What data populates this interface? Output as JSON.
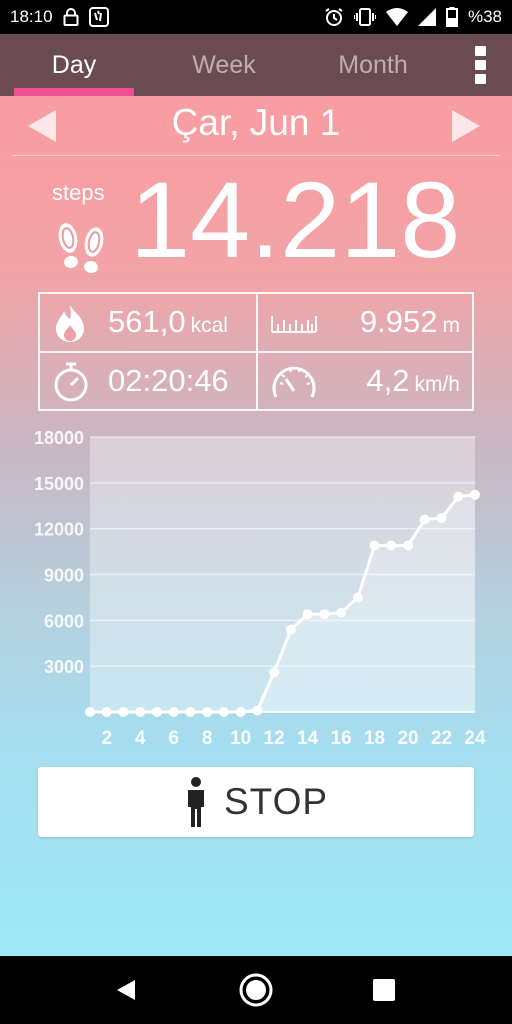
{
  "status_bar": {
    "time": "18:10",
    "battery": "%38",
    "icons": [
      "lock-icon",
      "app-notification-icon",
      "alarm-icon",
      "vibrate-icon",
      "wifi-icon",
      "signal-icon",
      "battery-icon"
    ]
  },
  "tabs": [
    {
      "label": "Day",
      "active": true
    },
    {
      "label": "Week",
      "active": false
    },
    {
      "label": "Month",
      "active": false
    }
  ],
  "date": "Çar, Jun 1",
  "steps": {
    "label": "steps",
    "value": "14.218"
  },
  "stats": {
    "calories": {
      "value": "561,0",
      "unit": "kcal"
    },
    "distance": {
      "value": "9.952",
      "unit": "m"
    },
    "duration": {
      "value": "02:20:46"
    },
    "speed": {
      "value": "4,2",
      "unit": "km/h"
    }
  },
  "chart_data": {
    "type": "line",
    "x": [
      1,
      2,
      3,
      4,
      5,
      6,
      7,
      8,
      9,
      10,
      11,
      12,
      13,
      14,
      15,
      16,
      17,
      18,
      19,
      20,
      21,
      22,
      23,
      24
    ],
    "values": [
      0,
      0,
      0,
      0,
      0,
      0,
      0,
      0,
      0,
      0,
      100,
      2600,
      5400,
      6400,
      6400,
      6500,
      7500,
      10900,
      10900,
      10900,
      12600,
      12700,
      14100,
      14218
    ],
    "xticks": [
      "2",
      "4",
      "6",
      "8",
      "10",
      "12",
      "14",
      "16",
      "18",
      "20",
      "22",
      "24"
    ],
    "yticks": [
      "3000",
      "6000",
      "9000",
      "12000",
      "15000",
      "18000"
    ],
    "ylim": [
      0,
      18000
    ],
    "xlim": [
      1,
      24
    ],
    "grid": true
  },
  "stop_button": {
    "label": "STOP"
  },
  "colors": {
    "tab_bar": "#6a4b52",
    "tab_accent": "#ee4f93",
    "gradient_top": "#fb9aa0",
    "gradient_bottom": "#9fe9f6"
  }
}
